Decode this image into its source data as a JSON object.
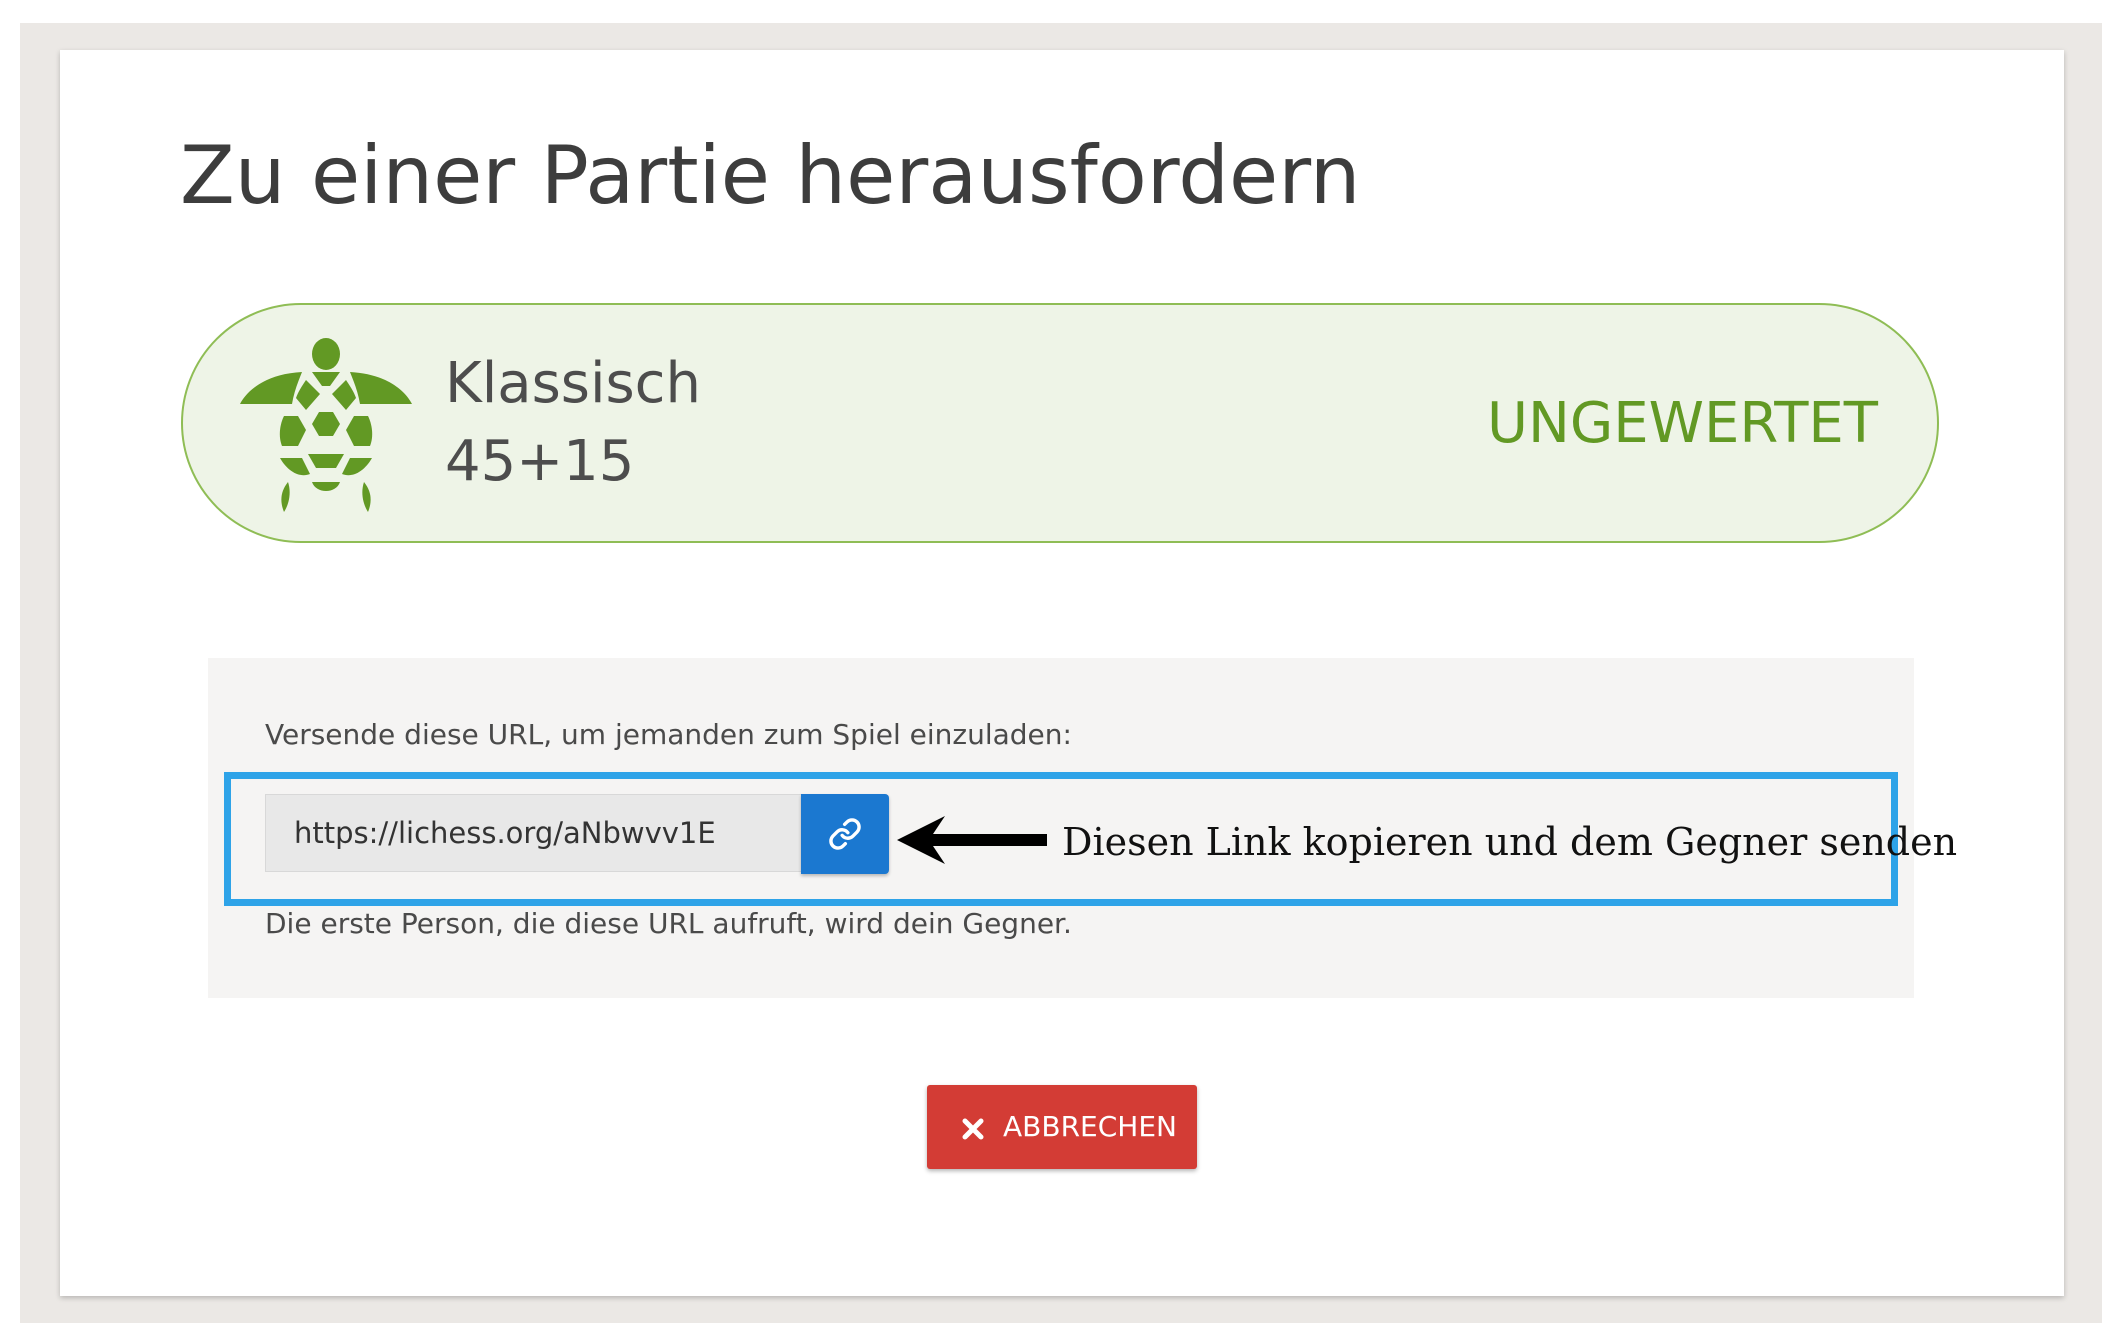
{
  "dialog": {
    "title": "Zu einer Partie herausfordern"
  },
  "variant": {
    "icon": "turtle-icon",
    "speed": "Klassisch",
    "clock": "45+15",
    "rated_status": "UNGEWERTET"
  },
  "invite": {
    "instruction": "Versende diese URL, um jemanden zum Spiel einzuladen:",
    "url": "https://lichess.org/aNbwvv1E",
    "copy_icon": "link-icon",
    "hint": "Die erste Person, die diese URL aufruft, wird dein Gegner."
  },
  "annotation": {
    "text": "Diesen Link kopieren und dem Gegner senden"
  },
  "actions": {
    "cancel_label": "ABBRECHEN",
    "cancel_icon": "close-icon"
  },
  "colors": {
    "pill_background": "#eef4e7",
    "pill_border": "#8fbd55",
    "rated_text": "#629924",
    "turtle": "#629924",
    "copy_button": "#1b78d0",
    "cancel_button": "#d33c35",
    "highlight_frame": "#2ea3e8"
  }
}
